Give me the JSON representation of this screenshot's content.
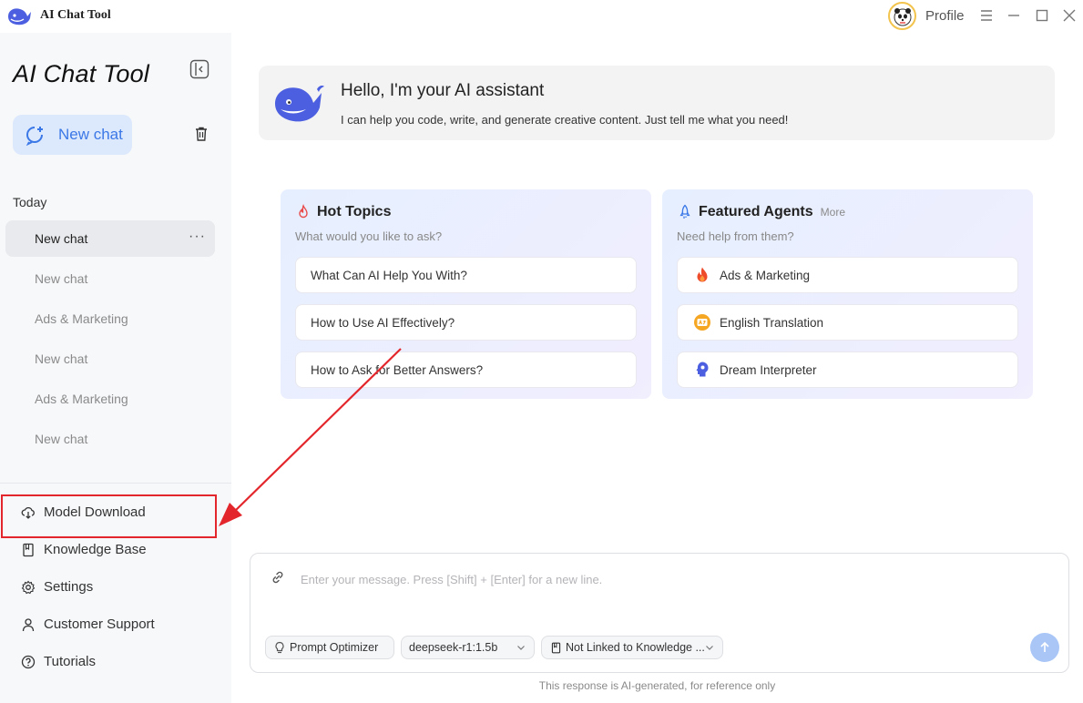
{
  "window": {
    "title": "AI Chat Tool",
    "profile_label": "Profile",
    "controls": [
      "menu-icon",
      "minimize-icon",
      "maximize-icon",
      "close-icon"
    ]
  },
  "sidebar": {
    "brand": "AI Chat Tool",
    "new_chat_label": "New chat",
    "section_label": "Today",
    "history": [
      {
        "label": "New chat",
        "active": true,
        "more": "···"
      },
      {
        "label": "New chat"
      },
      {
        "label": "Ads & Marketing"
      },
      {
        "label": "New chat"
      },
      {
        "label": "Ads & Marketing"
      },
      {
        "label": "New chat"
      }
    ],
    "bottom_nav": [
      {
        "label": "Model Download",
        "icon": "cloud-download-icon"
      },
      {
        "label": "Knowledge Base",
        "icon": "book-icon",
        "highlighted": true
      },
      {
        "label": "Settings",
        "icon": "gear-icon"
      },
      {
        "label": "Customer Support",
        "icon": "person-icon"
      },
      {
        "label": "Tutorials",
        "icon": "help-icon"
      }
    ]
  },
  "hello": {
    "title": "Hello, I'm your AI assistant",
    "subtitle": "I can help you code, write, and generate creative content. Just tell me what you need!"
  },
  "hot_topics": {
    "title": "Hot Topics",
    "subtitle": "What would you like to ask?",
    "items": [
      "What Can AI Help You With?",
      "How to Use AI Effectively?",
      "How to Ask for Better Answers?"
    ]
  },
  "featured_agents": {
    "title": "Featured Agents",
    "more": "More",
    "subtitle": "Need help from them?",
    "items": [
      {
        "label": "Ads & Marketing",
        "icon": "flame-icon"
      },
      {
        "label": "English Translation",
        "icon": "translate-icon"
      },
      {
        "label": "Dream Interpreter",
        "icon": "head-icon"
      }
    ]
  },
  "composer": {
    "placeholder": "Enter your message. Press [Shift] + [Enter] for a new line.",
    "prompt_optimizer": "Prompt Optimizer",
    "model": "deepseek-r1:1.5b",
    "knowledge": "Not Linked to Knowledge ..."
  },
  "footnote": "This response is AI-generated, for reference only",
  "colors": {
    "accent": "#3b78e7",
    "highlight": "#e3262b",
    "send": "#a9c6f7"
  }
}
